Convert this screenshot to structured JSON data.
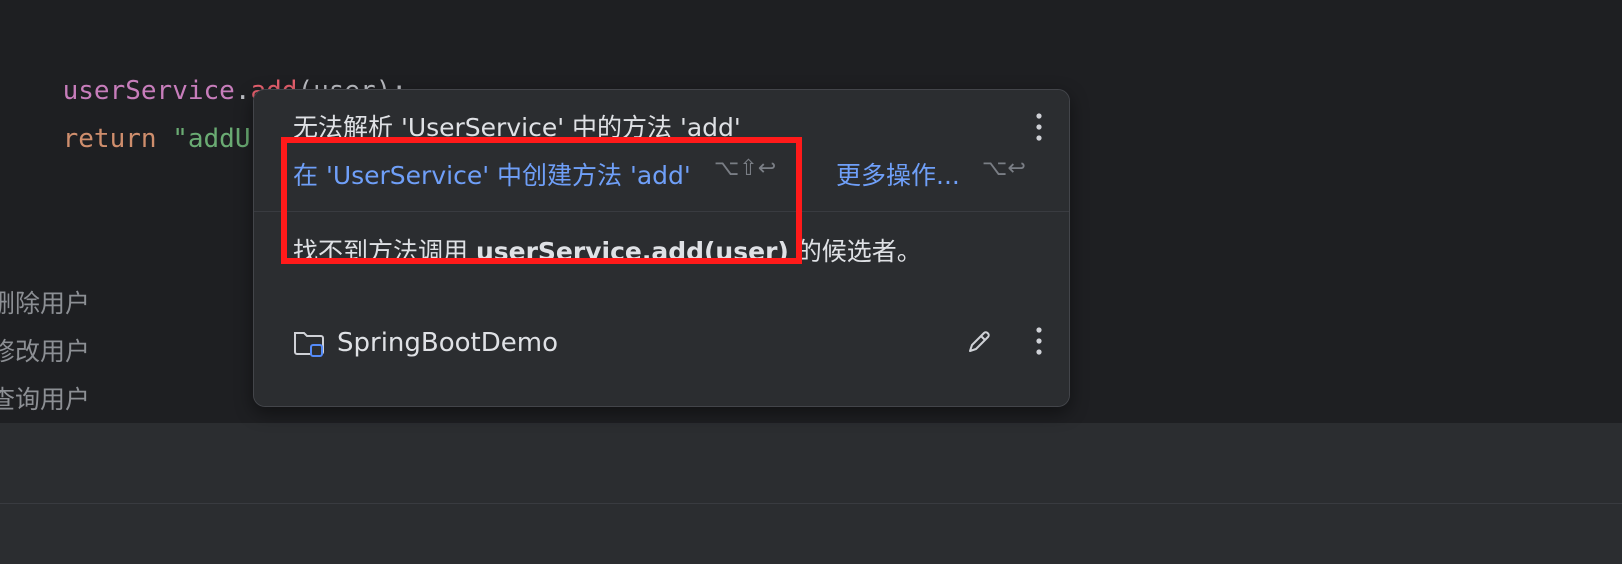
{
  "editor": {
    "line1": {
      "field": "userService",
      "dot": ".",
      "method": "add",
      "args": "(user);"
    },
    "line2": {
      "keyword": "return",
      "string_start": "\"addUser"
    },
    "comments": [
      "删除用户",
      "修改用户",
      "查询用户"
    ],
    "comment_prefixes": [
      "刪",
      "修",
      "查"
    ]
  },
  "popup": {
    "title": "无法解析 'UserService' 中的方法 'add'",
    "primary_action": "在 'UserService' 中创建方法 'add'",
    "primary_shortcut": "⌥⇧↩",
    "more_actions": "更多操作...",
    "more_shortcut": "⌥↩",
    "description_prefix": "找不到方法调用 ",
    "description_code": "userService.add(user)",
    "description_suffix": " 的候选者。",
    "project_name": "SpringBootDemo"
  },
  "icons": {
    "folder": "folder-icon",
    "edit": "pencil-icon",
    "menu": "more-vertical-icon"
  },
  "colors": {
    "link": "#6f9ff8",
    "highlight": "#ff1a1a",
    "popup_bg": "#2b2d30",
    "editor_bg": "#1e1f22"
  }
}
